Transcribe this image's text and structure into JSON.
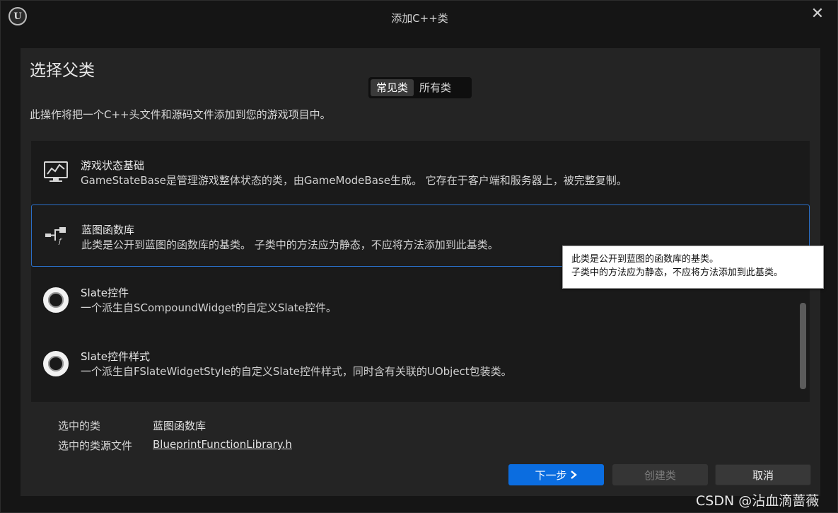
{
  "window": {
    "title": "添加C++类"
  },
  "dialog": {
    "heading": "选择父类",
    "tabs": [
      {
        "label": "常见类",
        "active": true
      },
      {
        "label": "所有类",
        "active": false
      }
    ],
    "description": "此操作将把一个C++头文件和源码文件添加到您的游戏项目中。",
    "classes": [
      {
        "icon": "gamestate-monitor-icon",
        "name": "游戏状态基础",
        "description": "GameStateBase是管理游戏整体状态的类，由GameModeBase生成。 它存在于客户端和服务器上，被完整复制。"
      },
      {
        "icon": "function-library-icon",
        "name": "蓝图函数库",
        "description": "此类是公开到蓝图的函数库的基类。 子类中的方法应为静态，不应将方法添加到此基类。",
        "selected": true
      },
      {
        "icon": "slate-widget-ring-icon",
        "name": "Slate控件",
        "description": "一个派生自SCompoundWidget的自定义Slate控件。"
      },
      {
        "icon": "slate-widget-ring-icon",
        "name": "Slate控件样式",
        "description": "一个派生自FSlateWidgetStyle的自定义Slate控件样式，同时含有关联的UObject包装类。"
      }
    ],
    "tooltip": {
      "line1": "此类是公开到蓝图的函数库的基类。",
      "line2": "子类中的方法应为静态，不应将方法添加到此基类。"
    },
    "selected_class_label": "选中的类",
    "selected_class_value": "蓝图函数库",
    "source_file_label": "选中的类源文件",
    "source_file_value": "BlueprintFunctionLibrary.h",
    "buttons": {
      "next": "下一步",
      "create": "创建类",
      "cancel": "取消"
    }
  },
  "watermark": "CSDN @沾血滴蔷薇",
  "colors": {
    "accent": "#0b6de0",
    "selection_border": "#2a6ec6",
    "background": "#242424"
  }
}
